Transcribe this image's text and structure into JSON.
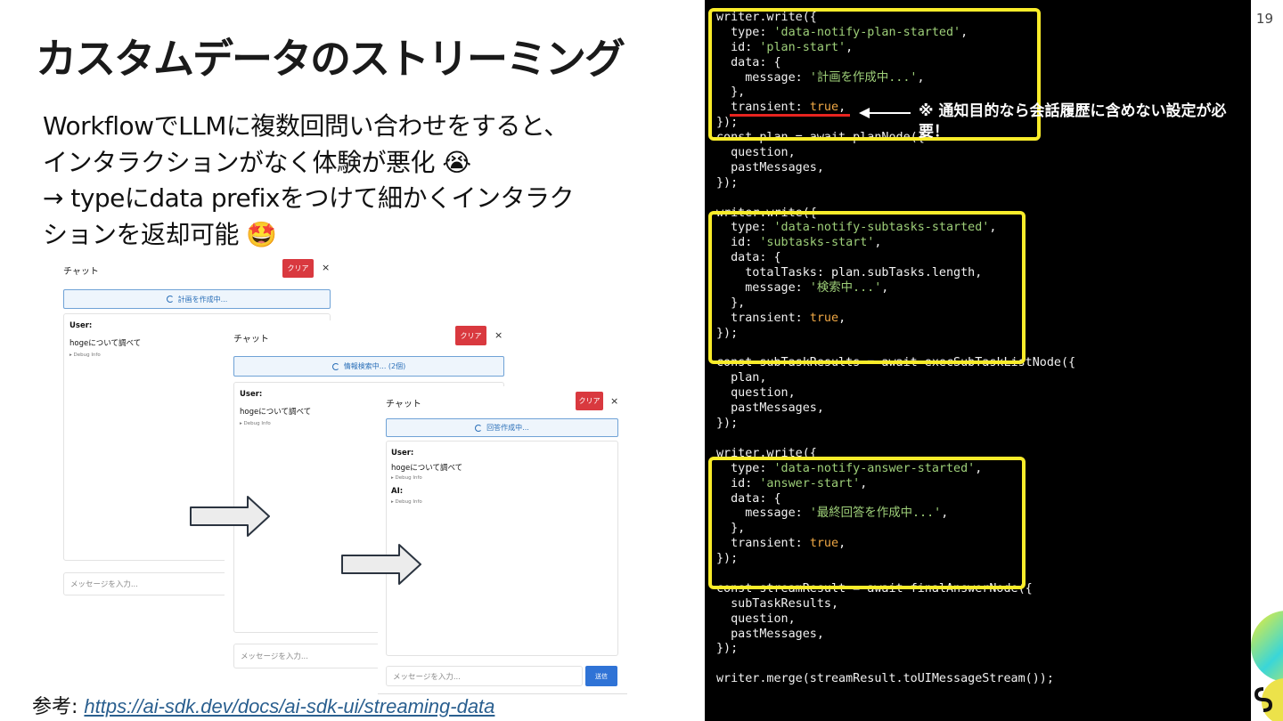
{
  "slide": {
    "title": "カスタムデータのストリーミング",
    "page_number": "19",
    "body_lines": [
      "WorkflowでLLMに複数回問い合わせをすると、",
      "インタラクションがなく体験が悪化 😭",
      "→ typeにdata prefixをつけて細かくインタラクションを返却可能 🤩"
    ],
    "body_lines_wrapped": [
      "WorkflowでLLMに複数回問い合わせをすると、",
      "インタラクションがなく体験が悪化 😭",
      "→ typeにdata prefixをつけて細かくインタラク",
      "ションを返却可能 🤩"
    ],
    "reference_label": "参考",
    "reference_separator": ": ",
    "reference_url": "https://ai-sdk.dev/docs/ai-sdk-ui/streaming-data"
  },
  "chat_screenshots": [
    {
      "title": "チャット",
      "clear_label": "クリア",
      "close_label": "×",
      "status": "計画を作成中...",
      "user_label": "User:",
      "user_message": "hogeについて調べて",
      "debug_label": "▸ Debug Info",
      "input_placeholder": "メッセージを入力..."
    },
    {
      "title": "チャット",
      "clear_label": "クリア",
      "close_label": "×",
      "status": "情報検索中... (2個)",
      "user_label": "User:",
      "user_message": "hogeについて調べて",
      "debug_label": "▸ Debug Info",
      "input_placeholder": "メッセージを入力..."
    },
    {
      "title": "チャット",
      "clear_label": "クリア",
      "close_label": "×",
      "status": "回答作成中...",
      "user_label": "User:",
      "user_message": "hogeについて調べて",
      "debug_label": "▸ Debug Info",
      "ai_label": "AI:",
      "ai_debug_label": "▸ Debug Info",
      "input_placeholder": "メッセージを入力...",
      "send_label": "送信"
    }
  ],
  "code": {
    "highlight_color": "#f9ec2a",
    "string_color": "#9ecf79",
    "keyword_color": "#f0a845",
    "lines": [
      "writer.write({",
      "  type: 'data-notify-plan-started',",
      "  id: 'plan-start',",
      "  data: {",
      "    message: '計画を作成中...',",
      "  },",
      "  transient: true,",
      "});",
      "const plan = await planNode({",
      "  question,",
      "  pastMessages,",
      "});",
      "",
      "writer.write({",
      "  type: 'data-notify-subtasks-started',",
      "  id: 'subtasks-start',",
      "  data: {",
      "    totalTasks: plan.subTasks.length,",
      "    message: '検索中...',",
      "  },",
      "  transient: true,",
      "});",
      "",
      "const subTaskResults = await execSubTaskListNode({",
      "  plan,",
      "  question,",
      "  pastMessages,",
      "});",
      "",
      "writer.write({",
      "  type: 'data-notify-answer-started',",
      "  id: 'answer-start',",
      "  data: {",
      "    message: '最終回答を作成中...',",
      "  },",
      "  transient: true,",
      "});",
      "",
      "const streamResult = await finalAnswerNode({",
      "  subTaskResults,",
      "  question,",
      "  pastMessages,",
      "});",
      "",
      "writer.merge(streamResult.toUIMessageStream());"
    ],
    "annotation": "※ 通知目的なら会話履歴に含めない設定が必要！"
  }
}
